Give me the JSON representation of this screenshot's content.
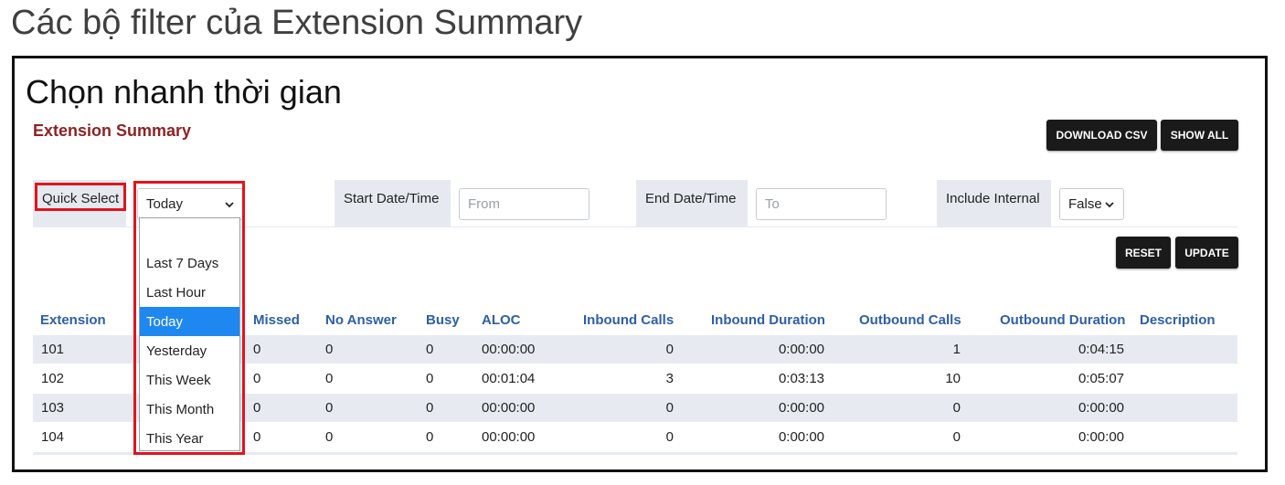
{
  "slide": {
    "title": "Các bộ filter của Extension Summary",
    "caption": "Chọn nhanh thời gian"
  },
  "app": {
    "title": "Extension Summary",
    "download_csv_label": "DOWNLOAD CSV",
    "show_all_label": "SHOW ALL",
    "reset_label": "RESET",
    "update_label": "UPDATE"
  },
  "filters": {
    "quick_select_label": "Quick Select",
    "quick_select_value": "Today",
    "start_label": "Start Date/Time",
    "start_placeholder": "From",
    "end_label": "End Date/Time",
    "end_placeholder": "To",
    "include_internal_label": "Include Internal",
    "include_internal_value": "False"
  },
  "dropdown": {
    "options": [
      "",
      "Last 7 Days",
      "Last Hour",
      "Today",
      "Yesterday",
      "This Week",
      "This Month",
      "This Year"
    ],
    "selected": "Today"
  },
  "table": {
    "columns": [
      "Extension",
      "Missed",
      "No Answer",
      "Busy",
      "ALOC",
      "Inbound Calls",
      "Inbound Duration",
      "Outbound Calls",
      "Outbound Duration",
      "Description"
    ],
    "rows": [
      {
        "extension": "101",
        "missed": "0",
        "no_answer": "0",
        "busy": "0",
        "aloc": "00:00:00",
        "inbound_calls": "0",
        "inbound_duration": "0:00:00",
        "outbound_calls": "1",
        "outbound_duration": "0:04:15",
        "description": ""
      },
      {
        "extension": "102",
        "missed": "0",
        "no_answer": "0",
        "busy": "0",
        "aloc": "00:01:04",
        "inbound_calls": "3",
        "inbound_duration": "0:03:13",
        "outbound_calls": "10",
        "outbound_duration": "0:05:07",
        "description": ""
      },
      {
        "extension": "103",
        "missed": "0",
        "no_answer": "0",
        "busy": "0",
        "aloc": "00:00:00",
        "inbound_calls": "0",
        "inbound_duration": "0:00:00",
        "outbound_calls": "0",
        "outbound_duration": "0:00:00",
        "description": ""
      },
      {
        "extension": "104",
        "missed": "0",
        "no_answer": "0",
        "busy": "0",
        "aloc": "00:00:00",
        "inbound_calls": "0",
        "inbound_duration": "0:00:00",
        "outbound_calls": "0",
        "outbound_duration": "0:00:00",
        "description": ""
      }
    ]
  },
  "colors": {
    "highlight_red": "#e0141e",
    "header_blue": "#2d5fa8",
    "title_maroon": "#8b2424",
    "selected_blue": "#1e88f0",
    "button_dark": "#1a1a1a",
    "row_alt": "#e7ebf1"
  }
}
